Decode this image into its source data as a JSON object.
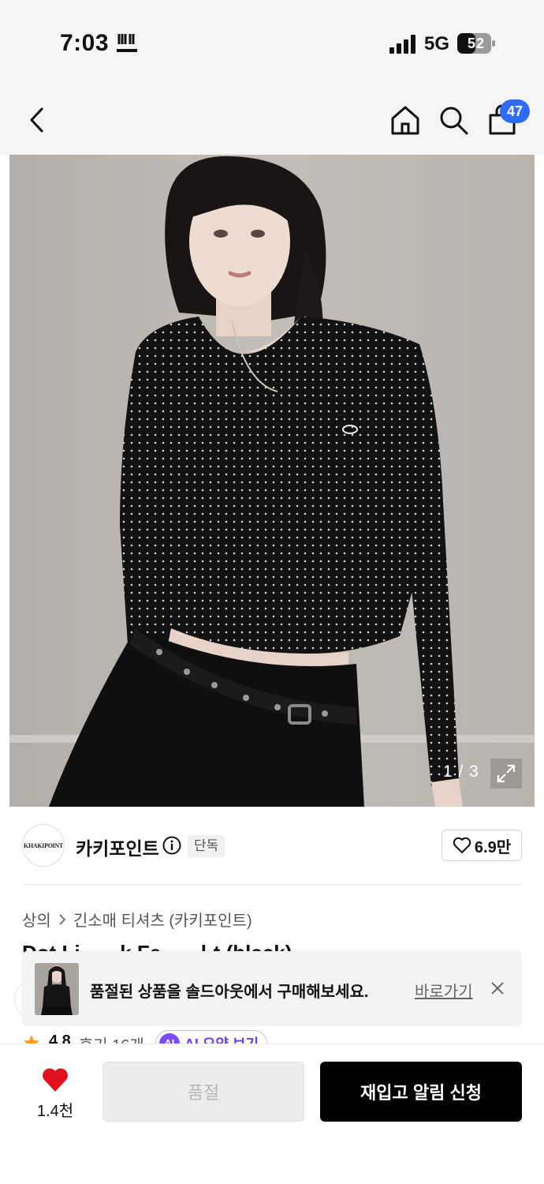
{
  "status_bar": {
    "time": "7:03",
    "network": "5G",
    "battery_level": "52"
  },
  "header": {
    "cart_count": "47"
  },
  "gallery": {
    "counter": "1 / 3"
  },
  "brand": {
    "logo_text": "KHAKIPOINT",
    "name": "카키포인트",
    "exclusive_badge": "단독",
    "like_count": "6.9만"
  },
  "breadcrumb": {
    "items": [
      "상의",
      "긴소매 티셔츠 (카키포인트)"
    ]
  },
  "product": {
    "title_partial": "Dot Li... ...k Fe... ...l-t (black)"
  },
  "toast": {
    "message": "품절된 상품을 솔드아웃에서 구매해보세요.",
    "link": "바로가기"
  },
  "rating": {
    "score": "4.8",
    "reviews": "후기 16개",
    "ai_badge": "AI",
    "ai_summary": "AI 요약 보기"
  },
  "bottom_bar": {
    "wish_count": "1.4천",
    "soldout_label": "품절",
    "restock_label": "재입고 알림 신청"
  },
  "colors": {
    "accent_blue": "#2f6bff",
    "heart_red": "#e0101e",
    "ai_purple": "#7b4dff",
    "primary_black": "#000000"
  }
}
